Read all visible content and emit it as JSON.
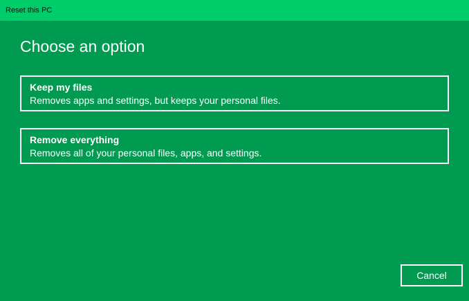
{
  "window": {
    "title": "Reset this PC"
  },
  "main": {
    "heading": "Choose an option",
    "options": [
      {
        "title": "Keep my files",
        "description": "Removes apps and settings, but keeps your personal files."
      },
      {
        "title": "Remove everything",
        "description": "Removes all of your personal files, apps, and settings."
      }
    ],
    "cancel_label": "Cancel"
  },
  "colors": {
    "titlebar": "#00cc6a",
    "background": "#009b50",
    "text": "#ffffff"
  }
}
